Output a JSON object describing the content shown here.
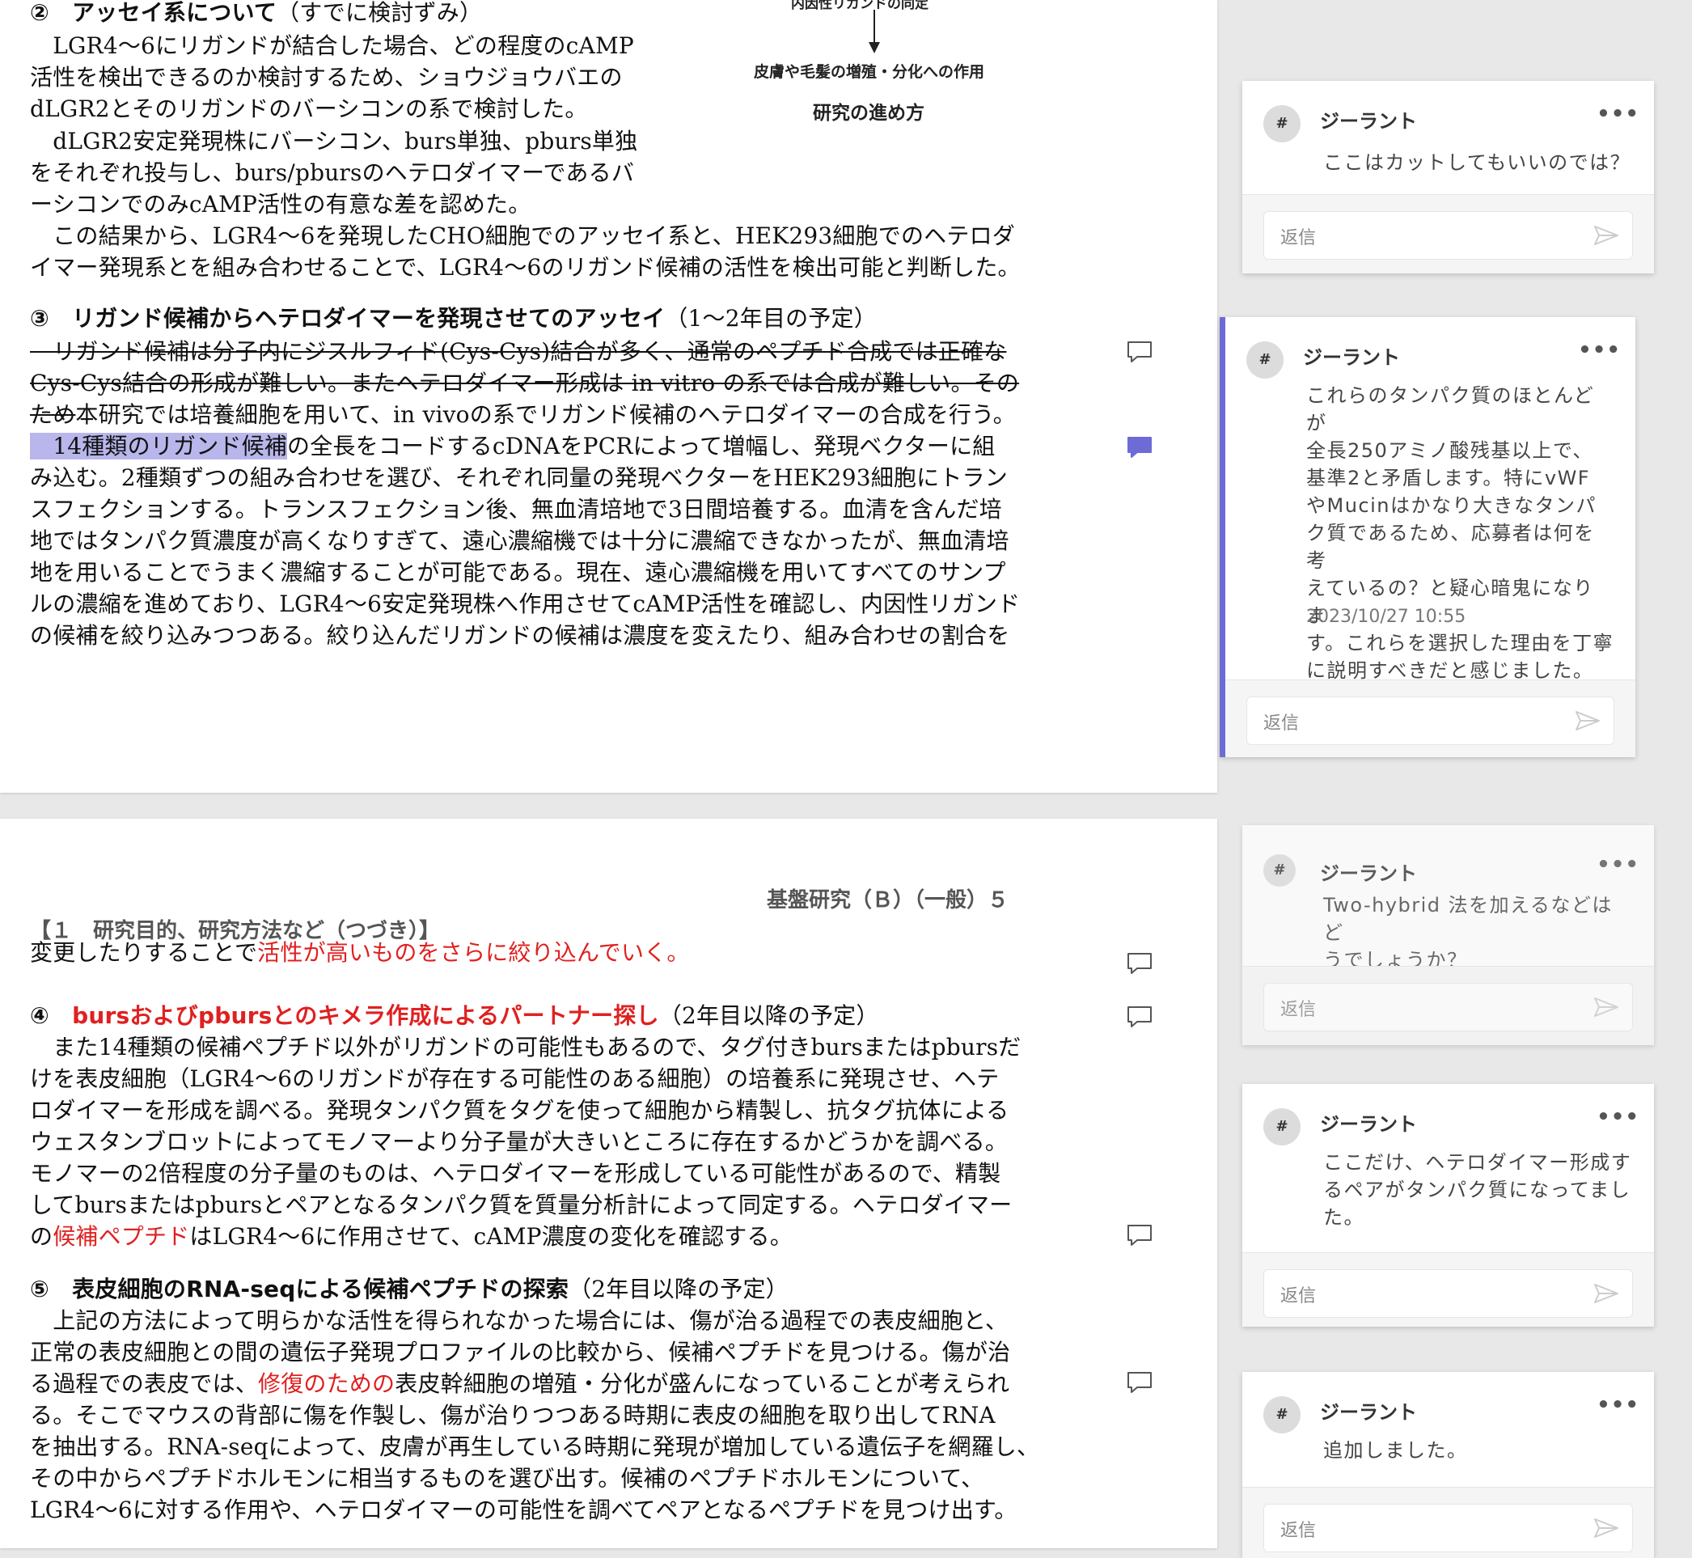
{
  "document": {
    "page1": {
      "lines": [
        {
          "parts": [
            {
              "text": "②　アッセイ系について",
              "style": "h"
            },
            {
              "text": "（すでに検討ずみ）",
              "style": "sub"
            }
          ]
        },
        {
          "parts": [
            {
              "text": "　LGR4〜6にリガンドが結合した場合、どの程度のcAMP"
            }
          ]
        },
        {
          "parts": [
            {
              "text": "活性を検出できるのか検討するため、ショウジョウバエの"
            }
          ]
        },
        {
          "parts": [
            {
              "text": "dLGR2とそのリガンドのバーシコンの系で検討した。"
            }
          ]
        },
        {
          "parts": [
            {
              "text": "　dLGR2安定発現株にバーシコン、burs単独、pburs単独"
            }
          ]
        },
        {
          "parts": [
            {
              "text": "をそれぞれ投与し、burs/pbursのヘテロダイマーであるバ"
            }
          ]
        },
        {
          "parts": [
            {
              "text": "ーシコンでのみcAMP活性の有意な差を認めた。"
            }
          ]
        },
        {
          "parts": [
            {
              "text": "　この結果から、LGR4〜6を発現したCHO細胞でのアッセイ系と、HEK293細胞でのヘテロダ"
            }
          ]
        },
        {
          "parts": [
            {
              "text": "イマー発現系とを組み合わせることで、LGR4〜6のリガンド候補の活性を検出可能と判断した。"
            }
          ]
        },
        {
          "parts": [
            {
              "text": "③　リガンド候補からヘテロダイマーを発現させてのアッセイ",
              "style": "h"
            },
            {
              "text": "（1〜2年目の予定）",
              "style": "sub"
            }
          ]
        },
        {
          "parts": [
            {
              "text": "　リガンド候補は分子内にジスルフィド(Cys-Cys)結合が多く、通常のペプチド合成では正確な",
              "style": "strike"
            }
          ]
        },
        {
          "parts": [
            {
              "text": "Cys-Cys結合の形成が難しい。またヘテロダイマー形成は in vitro の系では合成が難しい。その",
              "style": "strike"
            }
          ]
        },
        {
          "parts": [
            {
              "text": "ため",
              "style": "strike"
            },
            {
              "text": "本研究では培養細胞を用いて、in vivoの系でリガンド候補のヘテロダイマーの合成を行う。"
            }
          ]
        },
        {
          "parts": [
            {
              "text": "　14種類のリガンド候補",
              "style": "hl"
            },
            {
              "text": "の全長をコードするcDNAをPCRによって増幅し、発現ベクターに組"
            }
          ]
        },
        {
          "parts": [
            {
              "text": "み込む。2種類ずつの組み合わせを選び、それぞれ同量の発現ベクターをHEK293細胞にトラン"
            }
          ]
        },
        {
          "parts": [
            {
              "text": "スフェクションする。トランスフェクション後、無血清培地で3日間培養する。血清を含んだ培"
            }
          ]
        },
        {
          "parts": [
            {
              "text": "地ではタンパク質濃度が高くなりすぎて、遠心濃縮機では十分に濃縮できなかったが、無血清培"
            }
          ]
        },
        {
          "parts": [
            {
              "text": "地を用いることでうまく濃縮することが可能である。現在、遠心濃縮機を用いてすべてのサンプ"
            }
          ]
        },
        {
          "parts": [
            {
              "text": "ルの濃縮を進めており、LGR4〜6安定発現株へ作用させてcAMP活性を確認し、内因性リガンド"
            }
          ]
        },
        {
          "parts": [
            {
              "text": "の候補を絞り込みつつある。絞り込んだリガンドの候補は濃度を変えたり、組み合わせの割合を"
            }
          ]
        }
      ],
      "figure": {
        "top_label": "内因性リガンドの同定",
        "bottom_label": "皮膚や毛髪の増殖・分化への作用",
        "caption": "研究の進め方"
      }
    },
    "page2": {
      "header": "基盤研究（Ｂ）（一般）５",
      "section_title": "【１　研究目的、研究方法など（つづき）】",
      "lines": [
        {
          "parts": [
            {
              "text": "変更したりすることで"
            },
            {
              "text": "活性が高いものをさらに絞り込んでいく。",
              "style": "red"
            }
          ]
        },
        {
          "parts": [
            {
              "text": "④　",
              "style": "h"
            },
            {
              "text": "bursおよびpbursとのキメラ作成によるパートナー探し",
              "style": "h red"
            },
            {
              "text": "（2年目以降の予定）",
              "style": "sub"
            }
          ]
        },
        {
          "parts": [
            {
              "text": "　また14種類の候補ペプチド以外がリガンドの可能性もあるので、タグ付きbursまたはpbursだ"
            }
          ]
        },
        {
          "parts": [
            {
              "text": "けを表皮細胞（LGR4〜6のリガンドが存在する可能性のある細胞）の培養系に発現させ、ヘテ"
            }
          ]
        },
        {
          "parts": [
            {
              "text": "ロダイマーを形成を調べる。発現タンパク質をタグを使って細胞から精製し、抗タグ抗体による"
            }
          ]
        },
        {
          "parts": [
            {
              "text": "ウェスタンブロットによってモノマーより分子量が大きいところに存在するかどうかを調べる。"
            }
          ]
        },
        {
          "parts": [
            {
              "text": "モノマーの2倍程度の分子量のものは、ヘテロダイマーを形成している可能性があるので、精製"
            }
          ]
        },
        {
          "parts": [
            {
              "text": "してbursまたはpbursとペアとなるタンパク質を質量分析計によって同定する。ヘテロダイマー"
            }
          ]
        },
        {
          "parts": [
            {
              "text": "の"
            },
            {
              "text": "候補ペプチド",
              "style": "red"
            },
            {
              "text": "はLGR4〜6に作用させて、cAMP濃度の変化を確認する。"
            }
          ]
        },
        {
          "parts": [
            {
              "text": "⑤　表皮細胞のRNA-seqによる候補ペプチドの探索",
              "style": "h"
            },
            {
              "text": "（2年目以降の予定）",
              "style": "sub"
            }
          ]
        },
        {
          "parts": [
            {
              "text": "　上記の方法によって明らかな活性を得られなかった場合には、傷が治る過程での表皮細胞と、"
            }
          ]
        },
        {
          "parts": [
            {
              "text": "正常の表皮細胞との間の遺伝子発現プロファイルの比較から、候補ペプチドを見つける。傷が治"
            }
          ]
        },
        {
          "parts": [
            {
              "text": "る過程での表皮では、"
            },
            {
              "text": "修復のための",
              "style": "red"
            },
            {
              "text": "表皮幹細胞の増殖・分化が盛んになっていることが考えられ"
            }
          ]
        },
        {
          "parts": [
            {
              "text": "る。そこでマウスの背部に傷を作製し、傷が治りつつある時期に表皮の細胞を取り出してRNA"
            }
          ]
        },
        {
          "parts": [
            {
              "text": "を抽出する。RNA-seqによって、皮膚が再生している時期に発現が増加している遺伝子を網羅し、"
            }
          ]
        },
        {
          "parts": [
            {
              "text": "その中からペプチドホルモンに相当するものを選び出す。候補のペプチドホルモンについて、"
            }
          ]
        },
        {
          "parts": [
            {
              "text": "LGR4〜6に対する作用や、ヘテロダイマーの可能性を調べてペアとなるペプチドを見つけ出す。"
            }
          ]
        }
      ]
    }
  },
  "comments": [
    {
      "avatar": "#",
      "author": "ジーラント",
      "more": "•••",
      "text": "ここはカットしてもいいのでは？",
      "reply_placeholder": "返信"
    },
    {
      "avatar": "#",
      "author": "ジーラント",
      "more": "•••",
      "text": "これらのタンパク質のほとんどが\n全長250アミノ酸残基以上で、\n基準2と矛盾します。特にvWF\nやMucinはかなり大きなタンパ\nク質であるため、応募者は何を考\nえているの？と疑心暗鬼になりま\nす。これらを選択した理由を丁寧\nに説明すべきだと感じました。",
      "time": "2023/10/27 10:55",
      "reply_placeholder": "返信"
    },
    {
      "avatar": "#",
      "author": "ジーラント",
      "more": "•••",
      "text": "Two-hybrid 法を加えるなどはど\nうでしょうか？",
      "reply_placeholder": "返信"
    },
    {
      "avatar": "#",
      "author": "ジーラント",
      "more": "•••",
      "text": "ここだけ、ヘテロダイマー形成す\nるペアがタンパク質になってまし\nた。",
      "reply_placeholder": "返信"
    },
    {
      "avatar": "#",
      "author": "ジーラント",
      "more": "•••",
      "text": "追加しました。",
      "reply_placeholder": "返信"
    }
  ],
  "colors": {
    "accent": "#6d6bd6",
    "highlight": "#b8b6ea",
    "red_text": "#e02020"
  }
}
